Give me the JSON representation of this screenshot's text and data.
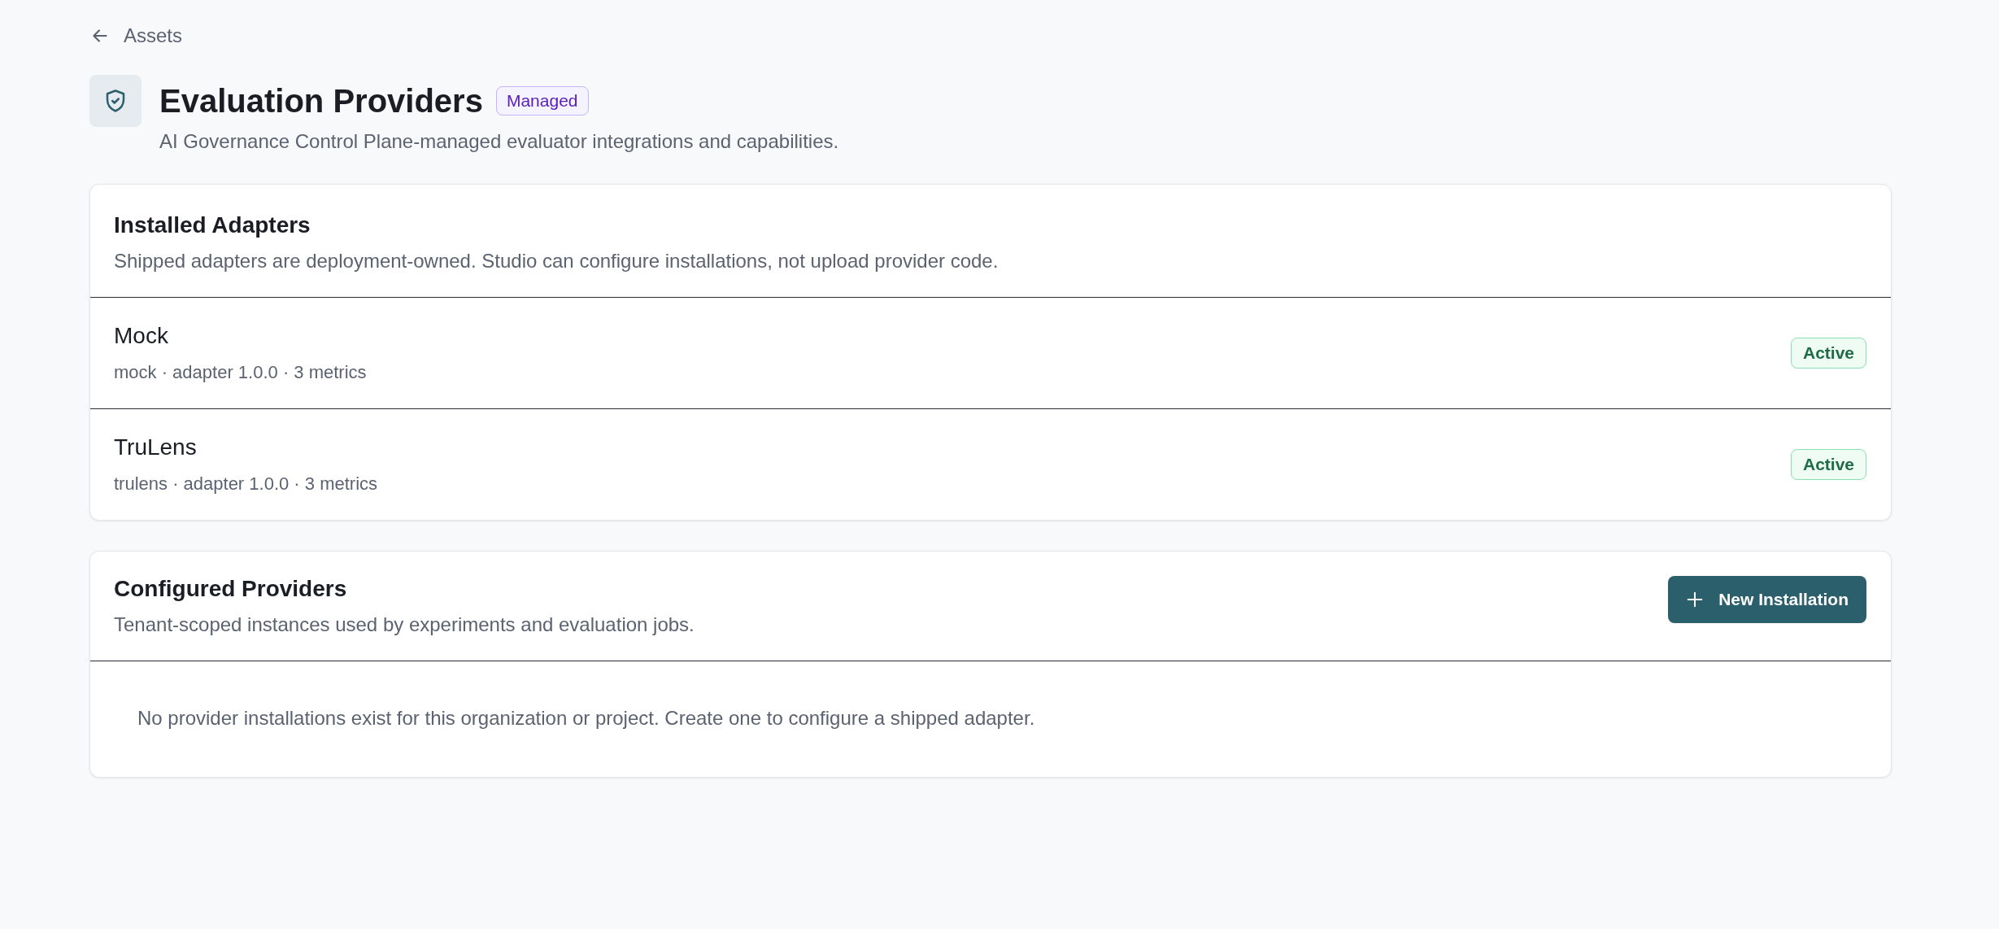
{
  "back_link": {
    "label": "Assets"
  },
  "header": {
    "title": "Evaluation Providers",
    "badge": "Managed",
    "subtitle": "AI Governance Control Plane-managed evaluator integrations and capabilities."
  },
  "installed_adapters": {
    "title": "Installed Adapters",
    "description": "Shipped adapters are deployment-owned. Studio can configure installations, not upload provider code.",
    "rows": [
      {
        "name": "Mock",
        "meta": "mock · adapter 1.0.0 · 3 metrics",
        "status": "Active"
      },
      {
        "name": "TruLens",
        "meta": "trulens · adapter 1.0.0 · 3 metrics",
        "status": "Active"
      }
    ]
  },
  "configured_providers": {
    "title": "Configured Providers",
    "description": "Tenant-scoped instances used by experiments and evaluation jobs.",
    "button": "New Installation",
    "empty_message": "No provider installations exist for this organization or project. Create one to configure a shipped adapter."
  }
}
